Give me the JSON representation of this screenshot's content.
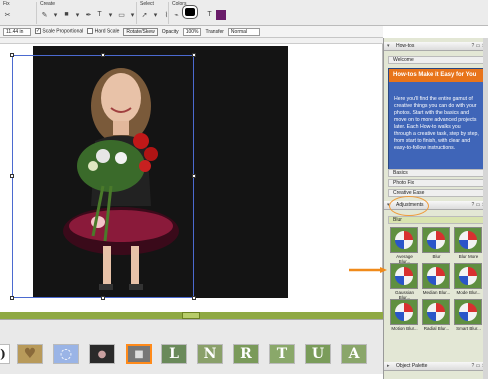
{
  "toolbar": {
    "groups": [
      {
        "title": "Fix"
      },
      {
        "title": "Create"
      },
      {
        "title": "Select"
      },
      {
        "title": "Colors"
      }
    ]
  },
  "options": {
    "width_value": "11.44 in",
    "scale_proportional": "Scale Proportional",
    "hard_scale": "Hard Scale",
    "rotate_skew": "Rotate/Skew",
    "opacity_label": "Opacity",
    "opacity_value": "100%",
    "transfer_label": "Transfer",
    "transfer_value": "Normal"
  },
  "panel": {
    "howtos_title": "How-tos",
    "welcome_tab": "Welcome",
    "welcome_heading": "How-tos Make it Easy for You",
    "welcome_body": "Here you'll find the entire gamut of creative things you can do with your photos. Start with the basics and move on to more advanced projects later. Each How-to walks you through a creative task, step by step, from start to finish, with clear and easy-to-follow instructions.",
    "basics": "Basics",
    "photo_fix": "Photo Fix",
    "creative_ease": "Creative Ease",
    "adjustments_title": "Adjustments",
    "blur_section": "Blur",
    "effects": [
      {
        "label": "Average Blur..."
      },
      {
        "label": "Blur"
      },
      {
        "label": "Blur More"
      },
      {
        "label": "Gaussian Blur..."
      },
      {
        "label": "Median Blur..."
      },
      {
        "label": "Mode Blur..."
      },
      {
        "label": "Motion Blur..."
      },
      {
        "label": "Radial Blur..."
      },
      {
        "label": "Smart Blur..."
      }
    ],
    "object_palette": "Object Palette"
  },
  "filmstrip": {
    "letters": [
      "L",
      "N",
      "R",
      "T",
      "U",
      "A"
    ]
  },
  "colors": {
    "accent_orange": "#e8741b",
    "welcome_blue": "#3f65b8",
    "selection_blue": "#4b6ad0",
    "green_strip": "#8fa944"
  }
}
